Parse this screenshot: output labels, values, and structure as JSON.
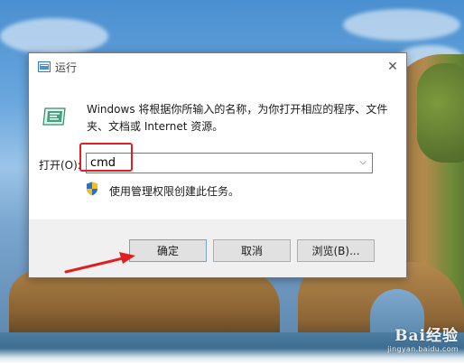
{
  "dialog": {
    "title": "运行",
    "close_glyph": "✕",
    "description": "Windows 将根据你所输入的名称，为你打开相应的程序、文件夹、文档或 Internet 资源。",
    "open_label": "打开(O):",
    "input_value": "cmd",
    "dropdown_glyph": "⌵",
    "admin_note": "使用管理权限创建此任务。",
    "buttons": {
      "ok": "确定",
      "cancel": "取消",
      "browse": "浏览(B)..."
    }
  },
  "watermark": {
    "logo": "Bai经验",
    "url": "jingyan.baidu.com"
  },
  "annotations": {
    "highlight_color": "#e02020",
    "arrow_color": "#e02020"
  },
  "icons": {
    "title": "run-icon",
    "content": "run-icon",
    "shield": "uac-shield-icon",
    "close": "close-icon",
    "dropdown": "chevron-down-icon"
  }
}
